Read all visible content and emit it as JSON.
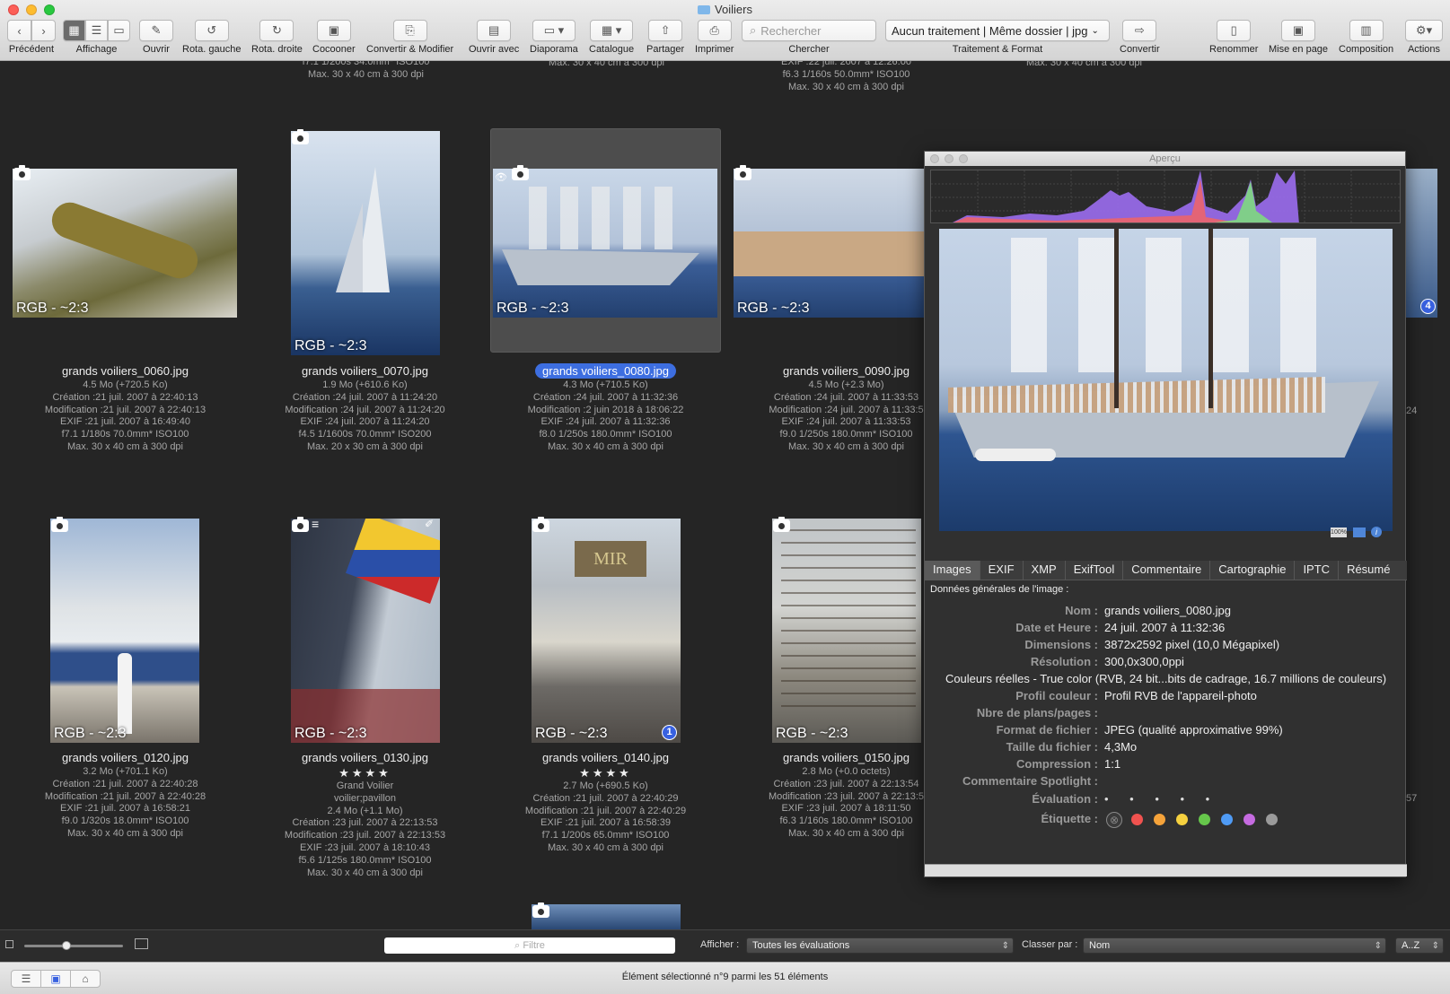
{
  "window": {
    "title": "Voiliers"
  },
  "toolbar": {
    "back_label": "Précédent",
    "view_label": "Affichage",
    "open_label": "Ouvrir",
    "rot_left_label": "Rota. gauche",
    "rot_right_label": "Rota. droite",
    "cocoon_label": "Cocooner",
    "convert_modify_label": "Convertir & Modifier",
    "open_with_label": "Ouvrir avec",
    "slideshow_label": "Diaporama",
    "catalog_label": "Catalogue",
    "share_label": "Partager",
    "print_label": "Imprimer",
    "search_placeholder": "Rechercher",
    "search_label": "Chercher",
    "process_value": "Aucun traitement | Même dossier | jpg",
    "process_label": "Traitement & Format",
    "convert_label": "Convertir",
    "rename_label": "Renommer",
    "layout_label": "Mise en page",
    "composition_label": "Composition",
    "actions_label": "Actions"
  },
  "overflow_top": {
    "c1_l1": "f7.1 1/200s 34.0mm* ISO100",
    "c1_l2": "Max. 30 x 40 cm à 300 dpi",
    "c2_l1": "Max. 30 x 40 cm à 300 dpi",
    "c3_l1": "EXIF :22 juil. 2007 à 12:26:00",
    "c3_l2": "f6.3 1/160s 50.0mm* ISO100",
    "c3_l3": "Max. 30 x 40 cm à 300 dpi",
    "c4_l1": "Max. 30 x 40 cm à 300 dpi"
  },
  "rgb_label": "RGB - ~2:3",
  "items": [
    {
      "name": "grands voiliers_0060.jpg",
      "size": "4.5  Mo (+720.5 Ko)",
      "created": "Création :21 juil. 2007 à 22:40:13",
      "modified": "Modification :21 juil. 2007 à 22:40:13",
      "exif": "EXIF :21 juil. 2007 à 16:49:40",
      "params": "f7.1 1/180s 70.0mm* ISO100",
      "max": "Max. 30 x 40 cm à 300 dpi"
    },
    {
      "name": "grands voiliers_0070.jpg",
      "size": "1.9  Mo (+610.6 Ko)",
      "created": "Création :24 juil. 2007 à 11:24:20",
      "modified": "Modification :24 juil. 2007 à 11:24:20",
      "exif": "EXIF :24 juil. 2007 à 11:24:20",
      "params": "f4.5 1/1600s 70.0mm* ISO200",
      "max": "Max. 20 x 30 cm à 300 dpi"
    },
    {
      "name": "grands voiliers_0080.jpg",
      "size": "4.3  Mo (+710.5 Ko)",
      "created": "Création :24 juil. 2007 à 11:32:36",
      "modified": "Modification :2 juin 2018 à 18:06:22",
      "exif": "EXIF :24 juil. 2007 à 11:32:36",
      "params": "f8.0 1/250s 180.0mm* ISO100",
      "max": "Max. 30 x 40 cm à 300 dpi"
    },
    {
      "name": "grands voiliers_0090.jpg",
      "size": "4.5  Mo (+2.3  Mo)",
      "created": "Création :24 juil. 2007 à 11:33:53",
      "modified": "Modification :24 juil. 2007 à 11:33:5",
      "exif": "EXIF :24 juil. 2007 à 11:33:53",
      "params": "f9.0 1/250s 180.0mm* ISO100",
      "max": "Max. 30 x 40 cm à 300 dpi"
    },
    {
      "name": "grands voiliers_0120.jpg",
      "size": "3.2  Mo (+701.1 Ko)",
      "created": "Création :21 juil. 2007 à 22:40:28",
      "modified": "Modification :21 juil. 2007 à 22:40:28",
      "exif": "EXIF :21 juil. 2007 à 16:58:21",
      "params": "f9.0 1/320s 18.0mm* ISO100",
      "max": "Max. 30 x 40 cm à 300 dpi"
    },
    {
      "name": "grands voiliers_0130.jpg",
      "stars": "★★★★",
      "comment1": "Grand Voilier",
      "comment2": "voilier;pavillon",
      "size": "2.4  Mo (+1.1  Mo)",
      "created": "Création :23 juil. 2007 à 22:13:53",
      "modified": "Modification :23 juil. 2007 à 22:13:53",
      "exif": "EXIF :23 juil. 2007 à 18:10:43",
      "params": "f5.6 1/125s 180.0mm* ISO100",
      "max": "Max. 30 x 40 cm à 300 dpi"
    },
    {
      "name": "grands voiliers_0140.jpg",
      "stars": "★★★★",
      "size": "2.7  Mo (+690.5 Ko)",
      "created": "Création :21 juil. 2007 à 22:40:29",
      "modified": "Modification :21 juil. 2007 à 22:40:29",
      "exif": "EXIF :21 juil. 2007 à 16:58:39",
      "params": "f7.1 1/200s 65.0mm* ISO100",
      "max": "Max. 30 x 40 cm à 300 dpi",
      "badge": "1"
    },
    {
      "name": "grands voiliers_0150.jpg",
      "size": "2.8  Mo (+0.0 octets)",
      "created": "Création :23 juil. 2007 à 22:13:54",
      "modified": "Modification :23 juil. 2007 à 22:13:5",
      "exif": "EXIF :23 juil. 2007 à 18:11:50",
      "params": "f6.3 1/160s 180.0mm* ISO100",
      "max": "Max. 30 x 40 cm à 300 dpi"
    }
  ],
  "edge": {
    "badge": "4",
    "frag1": "24",
    "frag2": "57"
  },
  "preview": {
    "title": "Aperçu",
    "zoom_label": "100%",
    "tabs": [
      "Images",
      "EXIF",
      "XMP",
      "ExifTool",
      "Commentaire",
      "Cartographie",
      "IPTC",
      "Résumé"
    ],
    "section": "Données générales de l'image :",
    "fields": {
      "name_k": "Nom :",
      "name_v": "grands voiliers_0080.jpg",
      "date_k": "Date et Heure :",
      "date_v": "24 juil. 2007 à 11:32:36",
      "dim_k": "Dimensions :",
      "dim_v": "3872x2592 pixel (10,0 Mégapixel)",
      "res_k": "Résolution :",
      "res_v": "300,0x300,0ppi",
      "colors_line": "Couleurs réelles - True color (RVB, 24 bit...bits de cadrage, 16.7 millions de couleurs)",
      "profile_k": "Profil couleur :",
      "profile_v": "Profil RVB de l'appareil-photo",
      "planes_k": "Nbre de plans/pages :",
      "format_k": "Format de fichier :",
      "format_v": "JPEG (qualité approximative 99%)",
      "size_k": "Taille du fichier :",
      "size_v": "4,3Mo",
      "comp_k": "Compression :",
      "comp_v": "1:1",
      "spot_k": "Commentaire Spotlight :",
      "rating_k": "Évaluation :",
      "rating_v": "• • • • •",
      "label_k": "Étiquette :"
    },
    "label_colors": [
      "#f0524f",
      "#f5a33a",
      "#f6d13f",
      "#66c74b",
      "#4f9bf5",
      "#c56be0",
      "#9a9a9a"
    ]
  },
  "bottom": {
    "filter_placeholder": "Filtre",
    "show_label": "Afficher :",
    "show_value": "Toutes les évaluations",
    "sort_label": "Classer par :",
    "sort_value": "Nom",
    "order_value": "A..Z"
  },
  "status": {
    "text": "Élément sélectionné n°9 parmi les 51 éléments"
  }
}
